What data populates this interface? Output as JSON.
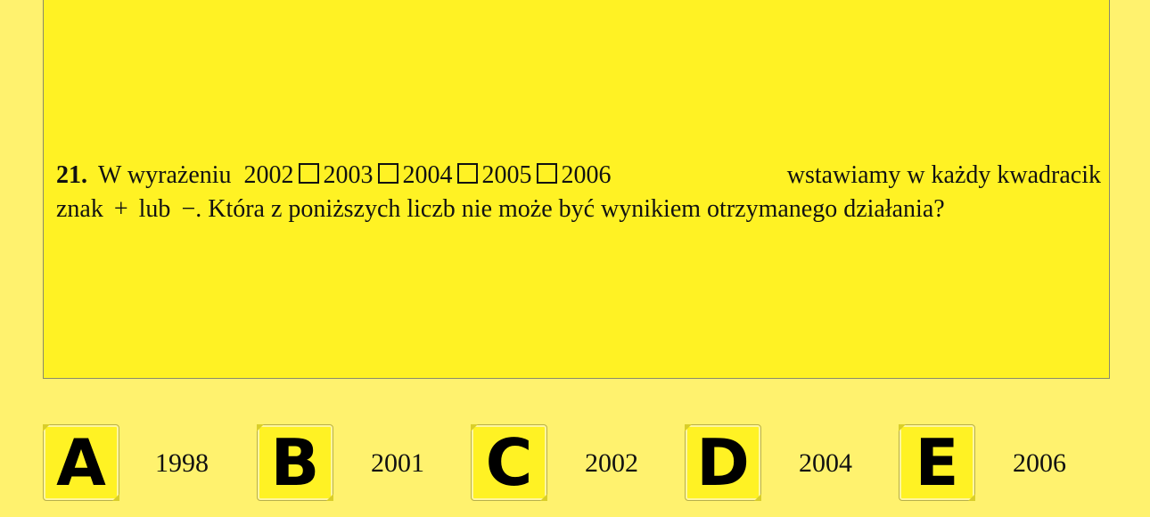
{
  "question": {
    "number": "21.",
    "intro": "W wyrażeniu",
    "numbers": [
      "2002",
      "2003",
      "2004",
      "2005",
      "2006"
    ],
    "line1_tail": "wstawiamy w każdy kwadracik",
    "line2_start": "znak",
    "plus": "+",
    "or": "lub",
    "minus": "−",
    "line2_tail": ". Która z poniższych liczb nie może być wynikiem otrzymanego działania?"
  },
  "answers": [
    {
      "letter": "A",
      "value": "1998"
    },
    {
      "letter": "B",
      "value": "2001"
    },
    {
      "letter": "C",
      "value": "2002"
    },
    {
      "letter": "D",
      "value": "2004"
    },
    {
      "letter": "E",
      "value": "2006"
    }
  ]
}
